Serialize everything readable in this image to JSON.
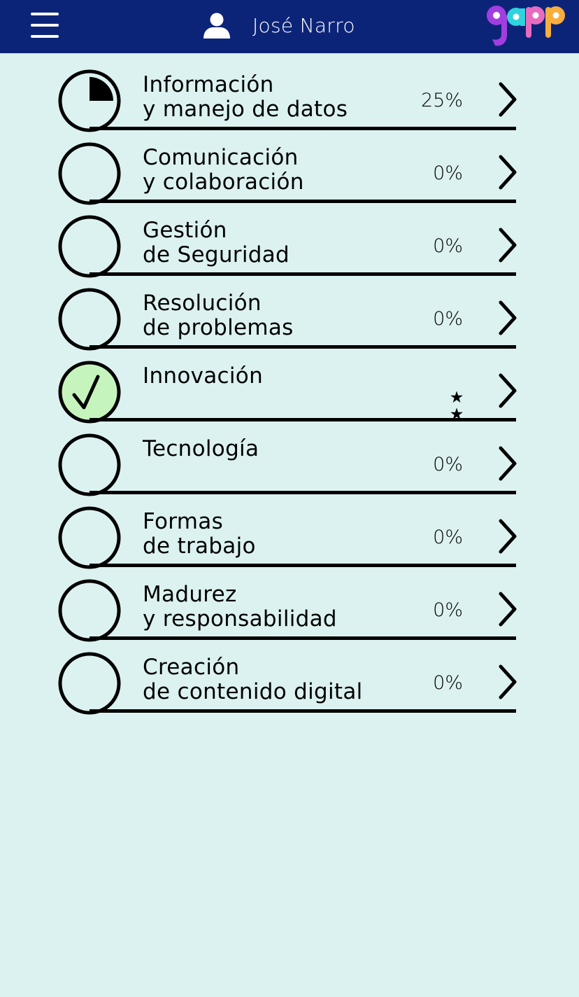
{
  "header": {
    "user_name": "José Narro",
    "logo_text": "gapp"
  },
  "colors": {
    "header_bg": "#0c2478",
    "page_bg": "#dcf2f0",
    "completed_fill": "#c6f4bd",
    "logo_letters": [
      "#a23ee0",
      "#2fd3de",
      "#e66cc0",
      "#f7ae3c"
    ]
  },
  "items": [
    {
      "line1": "Información",
      "line2": "y manejo de datos",
      "progress_text": "25%",
      "progress": 0.25,
      "status": "partial",
      "icon": "progress-pie-icon"
    },
    {
      "line1": "Comunicación",
      "line2": "y colaboración",
      "progress_text": "0%",
      "progress": 0,
      "status": "empty",
      "icon": "empty-circle-icon"
    },
    {
      "line1": "Gestión",
      "line2": "de Seguridad",
      "progress_text": "0%",
      "progress": 0,
      "status": "empty",
      "icon": "empty-circle-icon"
    },
    {
      "line1": "Resolución",
      "line2": "de problemas",
      "progress_text": "0%",
      "progress": 0,
      "status": "empty",
      "icon": "empty-circle-icon"
    },
    {
      "line1": "Innovación",
      "line2": "",
      "progress_text": "",
      "progress": 1,
      "status": "complete",
      "stars": 2,
      "icon": "check-circle-icon"
    },
    {
      "line1": "Tecnología",
      "line2": "",
      "progress_text": "0%",
      "progress": 0,
      "status": "empty",
      "icon": "empty-circle-icon"
    },
    {
      "line1": "Formas",
      "line2": "de trabajo",
      "progress_text": "0%",
      "progress": 0,
      "status": "empty",
      "icon": "empty-circle-icon"
    },
    {
      "line1": "Madurez",
      "line2": "y responsabilidad",
      "progress_text": "0%",
      "progress": 0,
      "status": "empty",
      "icon": "empty-circle-icon"
    },
    {
      "line1": "Creación",
      "line2": "de contenido digital",
      "progress_text": "0%",
      "progress": 0,
      "status": "empty",
      "icon": "empty-circle-icon"
    }
  ]
}
